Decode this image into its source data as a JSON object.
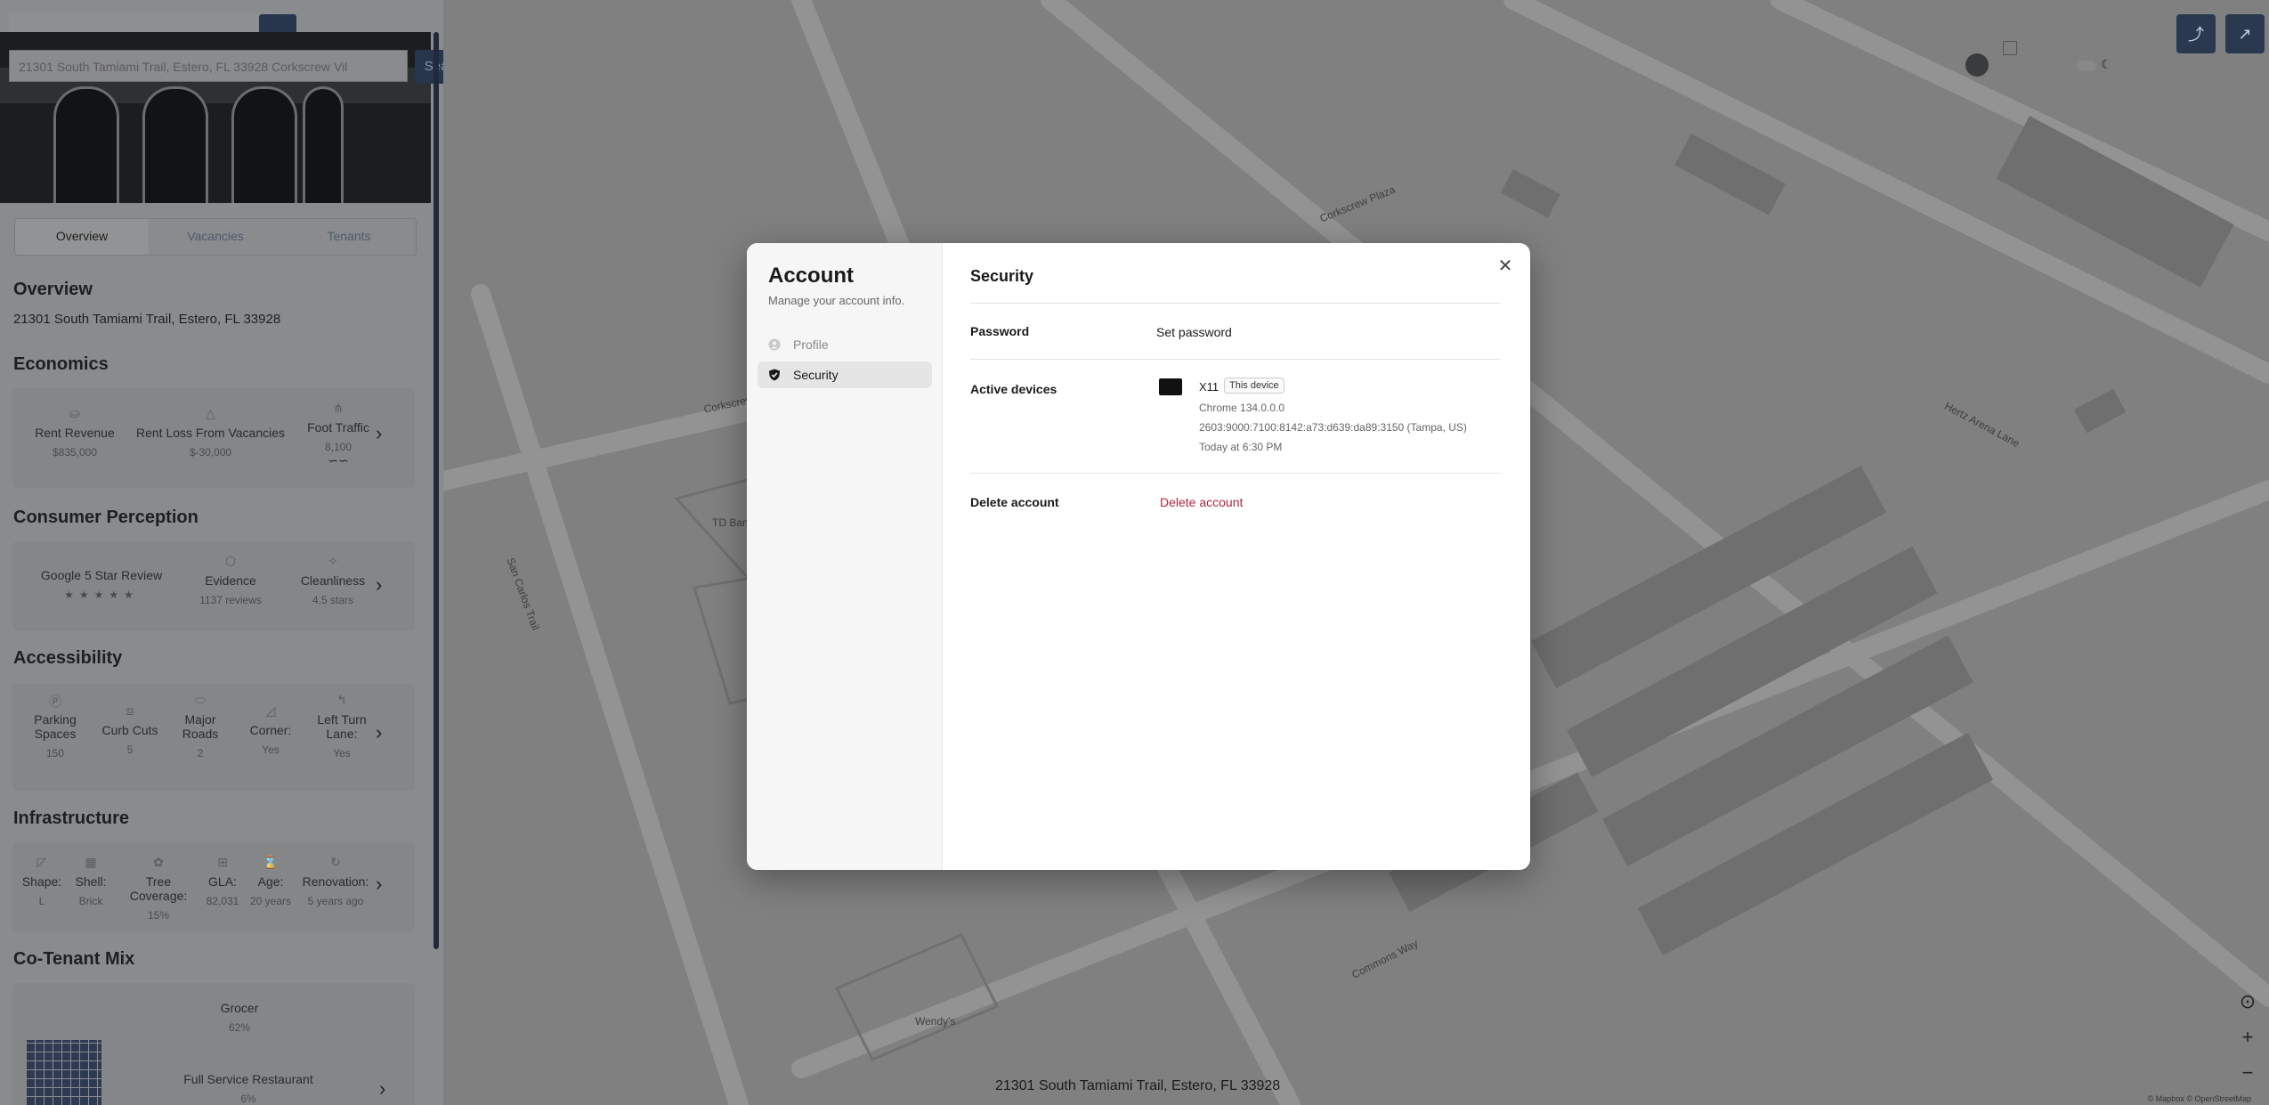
{
  "search": {
    "value": "21301 South Tamiami Trail, Estero, FL 33928 Corkscrew Vil",
    "button_label": "Search"
  },
  "tabs": [
    {
      "label": "Overview"
    },
    {
      "label": "Vacancies"
    },
    {
      "label": "Tenants"
    }
  ],
  "overview": {
    "title": "Overview",
    "address": "21301 South Tamiami Trail, Estero, FL 33928"
  },
  "economics": {
    "title": "Economics",
    "metrics": [
      {
        "label": "Rent Revenue",
        "value": "$835,000"
      },
      {
        "label": "Rent Loss From Vacancies",
        "value": "$-30,000"
      },
      {
        "label": "Foot Traffic",
        "value": "8,100"
      }
    ]
  },
  "perception": {
    "title": "Consumer Perception",
    "metrics": [
      {
        "label": "Google 5 Star Review",
        "value": "★★★★★"
      },
      {
        "label": "Evidence",
        "value": "1137 reviews"
      },
      {
        "label": "Cleanliness",
        "value": "4.5 stars"
      }
    ]
  },
  "accessibility": {
    "title": "Accessibility",
    "metrics": [
      {
        "label": "Parking Spaces",
        "value": "150"
      },
      {
        "label": "Curb Cuts",
        "value": "5"
      },
      {
        "label": "Major Roads",
        "value": "2"
      },
      {
        "label": "Corner:",
        "value": "Yes"
      },
      {
        "label": "Left Turn Lane:",
        "value": "Yes"
      }
    ]
  },
  "infrastructure": {
    "title": "Infrastructure",
    "metrics": [
      {
        "label": "Shape:",
        "value": "L"
      },
      {
        "label": "Shell:",
        "value": "Brick"
      },
      {
        "label": "Tree Coverage:",
        "value": "15%"
      },
      {
        "label": "GLA:",
        "value": "82,031"
      },
      {
        "label": "Age:",
        "value": "20 years"
      },
      {
        "label": "Renovation:",
        "value": "5 years ago"
      }
    ]
  },
  "cotenant": {
    "title": "Co-Tenant Mix",
    "items": [
      {
        "label": "Grocer",
        "value": "62%"
      },
      {
        "label": "Full Service Restaurant",
        "value": "6%"
      }
    ]
  },
  "map": {
    "bottom_address": "21301 South Tamiami Trail, Estero, FL 33928",
    "attribution": "© Mapbox © OpenStreetMap"
  },
  "modal": {
    "side_title": "Account",
    "side_subtitle": "Manage your account info.",
    "nav": [
      {
        "label": "Profile",
        "icon": "user-circle-icon",
        "active": false
      },
      {
        "label": "Security",
        "icon": "shield-icon",
        "active": true
      }
    ],
    "title": "Security",
    "password": {
      "label": "Password",
      "value": "Set password"
    },
    "devices": {
      "label": "Active devices",
      "name": "X11",
      "badge": "This device",
      "browser": "Chrome 134.0.0.0",
      "ip_location": "2603:9000:7100:8142:a73:d639:da89:3150 (Tampa, US)",
      "last_active": "Today at 6:30 PM"
    },
    "delete": {
      "label": "Delete account",
      "action": "Delete account"
    }
  },
  "colors": {
    "navy": "#27364c",
    "danger": "#b3263e",
    "map_bg": "#7f807f"
  }
}
